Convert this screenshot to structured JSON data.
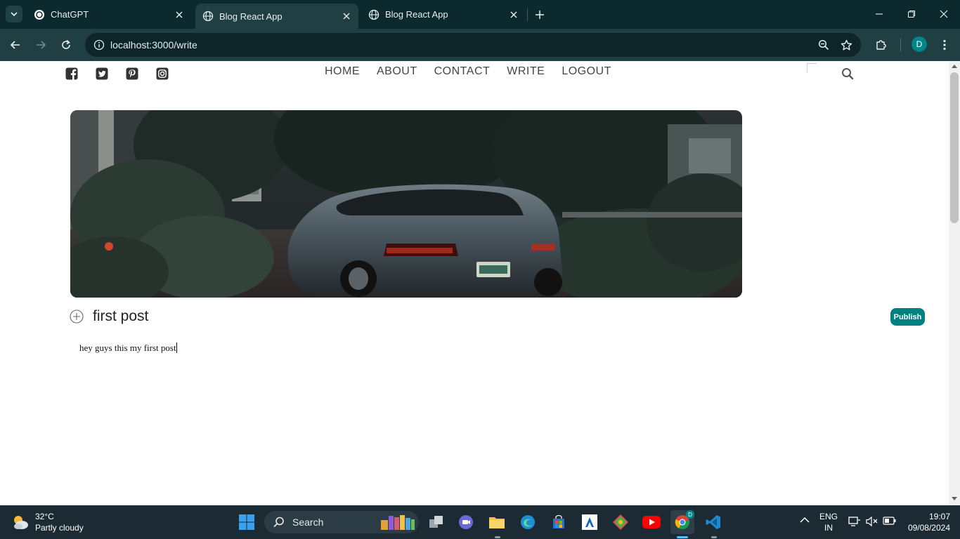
{
  "browser": {
    "tabs": [
      {
        "title": "ChatGPT",
        "active": false
      },
      {
        "title": "Blog React App",
        "active": true
      },
      {
        "title": "Blog React App",
        "active": false
      }
    ],
    "url": "localhost:3000/write",
    "profile_initial": "D",
    "colors": {
      "tabstrip": "#0c2a2e",
      "toolbar": "#1f3f42",
      "profile": "#00858a"
    }
  },
  "topbar": {
    "social_icons": [
      "facebook-icon",
      "twitter-icon",
      "pinterest-icon",
      "instagram-icon"
    ],
    "nav": [
      "HOME",
      "ABOUT",
      "CONTACT",
      "WRITE",
      "LOGOUT"
    ]
  },
  "write": {
    "title_value": "first post",
    "body_value": "hey guys this my first post",
    "publish_label": "Publish",
    "accent": "#008080"
  },
  "taskbar": {
    "weather_temp": "32°C",
    "weather_desc": "Partly cloudy",
    "search_label": "Search",
    "lang_top": "ENG",
    "lang_bottom": "IN",
    "time": "19:07",
    "date": "09/08/2024"
  }
}
